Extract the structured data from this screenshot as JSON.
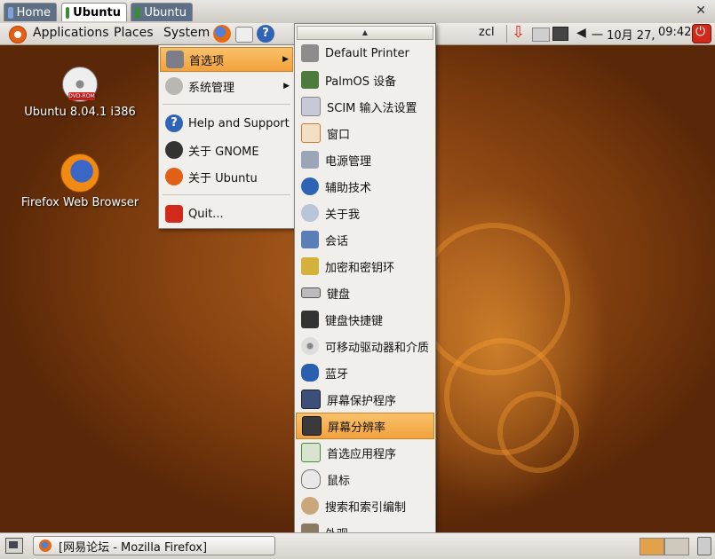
{
  "vm_tabs": [
    {
      "label": "Home",
      "active": false
    },
    {
      "label": "Ubuntu",
      "active": true
    },
    {
      "label": "Ubuntu",
      "active": false
    }
  ],
  "top_panel": {
    "menus": [
      "Applications",
      "Places",
      "System"
    ],
    "user": "zcl",
    "date": "一 10月 27,",
    "time": "09:42"
  },
  "desktop_icons": [
    {
      "label": "Ubuntu 8.04.1 i386",
      "icon": "dvd-rom-icon",
      "badge": "DVD-ROM"
    },
    {
      "label": "Firefox Web Browser",
      "icon": "firefox-icon"
    }
  ],
  "system_menu": {
    "items": [
      {
        "label": "首选项",
        "icon": "preferences-icon",
        "submenu": true,
        "highlighted": true
      },
      {
        "label": "系统管理",
        "icon": "administration-icon",
        "submenu": true
      },
      {
        "label": "Help and Support",
        "icon": "help-icon"
      },
      {
        "label": "关于 GNOME",
        "icon": "gnome-foot-icon"
      },
      {
        "label": "关于 Ubuntu",
        "icon": "ubuntu-logo-icon"
      },
      {
        "label": "Quit...",
        "icon": "quit-icon"
      }
    ]
  },
  "preferences_submenu": {
    "items": [
      {
        "label": "Default Printer",
        "icon": "printer-icon"
      },
      {
        "label": "PalmOS 设备",
        "icon": "palm-device-icon"
      },
      {
        "label": "SCIM 输入法设置",
        "icon": "scim-icon"
      },
      {
        "label": "窗口",
        "icon": "window-icon"
      },
      {
        "label": "电源管理",
        "icon": "power-management-icon"
      },
      {
        "label": "辅助技术",
        "icon": "accessibility-icon"
      },
      {
        "label": "关于我",
        "icon": "about-me-icon"
      },
      {
        "label": "会话",
        "icon": "session-icon"
      },
      {
        "label": "加密和密钥环",
        "icon": "keyring-icon"
      },
      {
        "label": "键盘",
        "icon": "keyboard-icon"
      },
      {
        "label": "键盘快捷键",
        "icon": "keyboard-shortcuts-icon"
      },
      {
        "label": "可移动驱动器和介质",
        "icon": "removable-media-icon"
      },
      {
        "label": "蓝牙",
        "icon": "bluetooth-icon"
      },
      {
        "label": "屏幕保护程序",
        "icon": "screensaver-icon"
      },
      {
        "label": "屏幕分辨率",
        "icon": "screen-resolution-icon",
        "highlighted": true
      },
      {
        "label": "首选应用程序",
        "icon": "preferred-apps-icon"
      },
      {
        "label": "鼠标",
        "icon": "mouse-icon"
      },
      {
        "label": "搜索和索引编制",
        "icon": "search-indexing-icon"
      },
      {
        "label": "外观",
        "icon": "appearance-icon"
      }
    ]
  },
  "bottom_panel": {
    "task": "[网易论坛 - Mozilla Firefox]"
  },
  "colors": {
    "highlight": "#f2a23c",
    "panel": "#e3e0db",
    "desktop": "#9a4e16"
  }
}
